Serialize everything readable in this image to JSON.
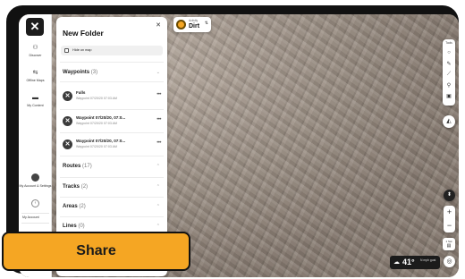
{
  "rail": {
    "items": [
      {
        "icon": "binoculars-icon",
        "label": "Discover"
      },
      {
        "icon": "offline-maps-icon",
        "label": "Offline Maps"
      },
      {
        "icon": "folder-icon",
        "label": "My Content"
      }
    ],
    "account_label": "My Account & Settings",
    "footer_items": [
      "My Account",
      "Settings"
    ]
  },
  "panel": {
    "title": "New Folder",
    "hide_on_map_label": "Hide on map",
    "waypoints": {
      "name": "Waypoints",
      "count": "(3)",
      "items": [
        {
          "name": "Falls",
          "date": "Waypoint 07/20/20 07:03 AM"
        },
        {
          "name": "Waypoint 07/20/20, 07:0...",
          "date": "Waypoint 07/20/20 07:03 AM"
        },
        {
          "name": "Waypoint 07/20/20, 07:0...",
          "date": "Waypoint 07/20/20 07:03 AM"
        }
      ]
    },
    "sections": [
      {
        "name": "Routes",
        "count": "(17)"
      },
      {
        "name": "Tracks",
        "count": "(2)"
      },
      {
        "name": "Areas",
        "count": "(2)"
      },
      {
        "name": "Lines",
        "count": "(0)"
      }
    ]
  },
  "chip": {
    "label": "Activity",
    "value": "Dirt"
  },
  "tools": {
    "label": "Tools",
    "icons": [
      "circle-icon",
      "pencil-icon",
      "ruler-icon",
      "pin-icon",
      "camera-icon"
    ]
  },
  "weather": {
    "temp": "41°",
    "wind": "N mph gust"
  },
  "layers_label": "1 Sat",
  "share_label": "Share",
  "colors": {
    "accent": "#f5a623",
    "panel": "#ffffff",
    "frame": "#111111"
  }
}
